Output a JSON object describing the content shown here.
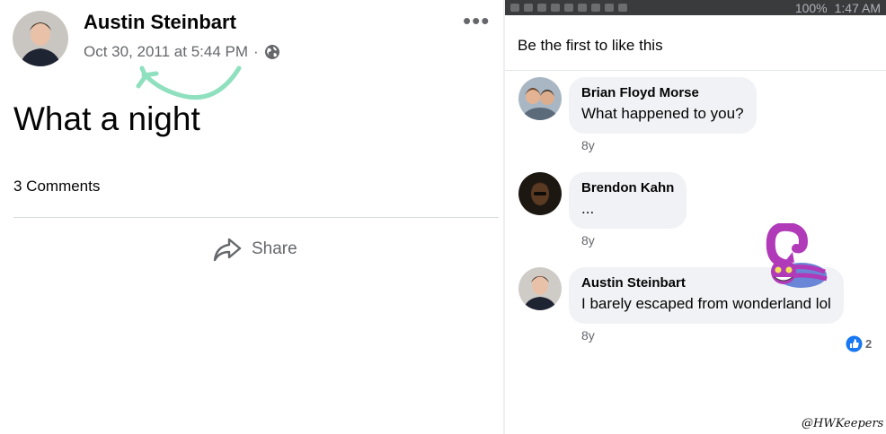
{
  "post": {
    "author": "Austin Steinbart",
    "timestamp": "Oct 30, 2011 at 5:44 PM",
    "separator": "·",
    "text": "What a night",
    "comment_count": "3 Comments",
    "share_label": "Share",
    "more_menu": "•••"
  },
  "status_bar": {
    "battery": "100%",
    "time": "1:47 AM"
  },
  "comments_sheet": {
    "likes_line": "Be the first to like this",
    "comments": [
      {
        "author": "Brian Floyd Morse",
        "text": "What happened to you?",
        "time": "8y"
      },
      {
        "author": "Brendon Kahn",
        "text": "...",
        "time": "8y"
      },
      {
        "author": "Austin Steinbart",
        "text": "I barely escaped from wonderland lol",
        "time": "8y",
        "reaction_count": "2"
      }
    ]
  },
  "watermark": "@HWKeepers",
  "colors": {
    "annotation_arrow": "#8fe0be",
    "meta_gray": "#65676b",
    "bubble_bg": "#f0f2f5",
    "like_blue": "#1877f2",
    "status_bar_bg": "#3a3b3c",
    "cat_purple": "#b03ab8"
  },
  "icons": {
    "globe": "globe-icon",
    "share": "share-arrow-icon",
    "like_reaction": "thumbs-up-icon",
    "sticker": "cheshire-cat-sticker"
  }
}
